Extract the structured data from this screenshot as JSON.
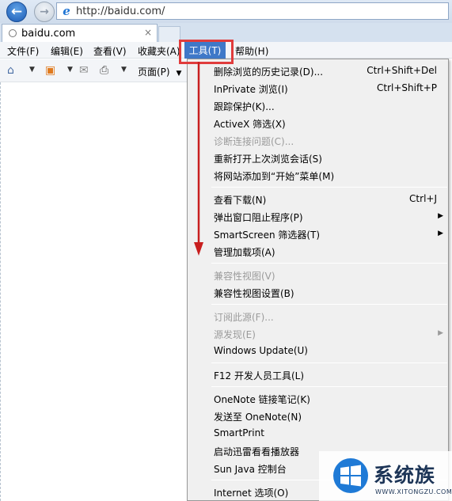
{
  "navbar": {
    "url": "http://baidu.com/"
  },
  "tab": {
    "title": "baidu.com",
    "close": "×"
  },
  "menubar": {
    "items": [
      "文件(F)",
      "编辑(E)",
      "查看(V)",
      "收藏夹(A)",
      "工具(T)",
      "帮助(H)"
    ]
  },
  "cmdbar": {
    "page_label": "页面(P)"
  },
  "tools_menu": [
    {
      "label": "删除浏览的历史记录(D)...",
      "shortcut": "Ctrl+Shift+Del",
      "disabled": false
    },
    {
      "label": "InPrivate 浏览(I)",
      "shortcut": "Ctrl+Shift+P",
      "disabled": false
    },
    {
      "label": "跟踪保护(K)...",
      "shortcut": "",
      "disabled": false
    },
    {
      "label": "ActiveX 筛选(X)",
      "shortcut": "",
      "disabled": false
    },
    {
      "label": "诊断连接问题(C)...",
      "shortcut": "",
      "disabled": true
    },
    {
      "label": "重新打开上次浏览会话(S)",
      "shortcut": "",
      "disabled": false
    },
    {
      "label": "将网站添加到“开始”菜单(M)",
      "shortcut": "",
      "disabled": false
    },
    {
      "label": "查看下载(N)",
      "shortcut": "Ctrl+J",
      "disabled": false
    },
    {
      "label": "弹出窗口阻止程序(P)",
      "shortcut": "",
      "disabled": false,
      "submenu": true
    },
    {
      "label": "SmartScreen 筛选器(T)",
      "shortcut": "",
      "disabled": false,
      "submenu": true
    },
    {
      "label": "管理加载项(A)",
      "shortcut": "",
      "disabled": false
    },
    {
      "label": "兼容性视图(V)",
      "shortcut": "",
      "disabled": true
    },
    {
      "label": "兼容性视图设置(B)",
      "shortcut": "",
      "disabled": false
    },
    {
      "label": "订阅此源(F)...",
      "shortcut": "",
      "disabled": true
    },
    {
      "label": "源发现(E)",
      "shortcut": "",
      "disabled": true,
      "submenu": true
    },
    {
      "label": "Windows Update(U)",
      "shortcut": "",
      "disabled": false
    },
    {
      "label": "F12 开发人员工具(L)",
      "shortcut": "",
      "disabled": false
    },
    {
      "label": "OneNote 链接笔记(K)",
      "shortcut": "",
      "disabled": false
    },
    {
      "label": "发送至 OneNote(N)",
      "shortcut": "",
      "disabled": false
    },
    {
      "label": "SmartPrint",
      "shortcut": "",
      "disabled": false
    },
    {
      "label": "启动迅雷看看播放器",
      "shortcut": "",
      "disabled": false
    },
    {
      "label": "Sun Java 控制台",
      "shortcut": "",
      "disabled": false
    },
    {
      "label": "Internet 选项(O)",
      "shortcut": "",
      "disabled": false
    }
  ],
  "watermark": {
    "name": "系统族",
    "url": "WWW.XITONGZU.COM"
  },
  "colors": {
    "menu_highlight": "#3f78c8",
    "annotation_red": "#e03c3c",
    "disabled_text": "#9b9b9b"
  }
}
